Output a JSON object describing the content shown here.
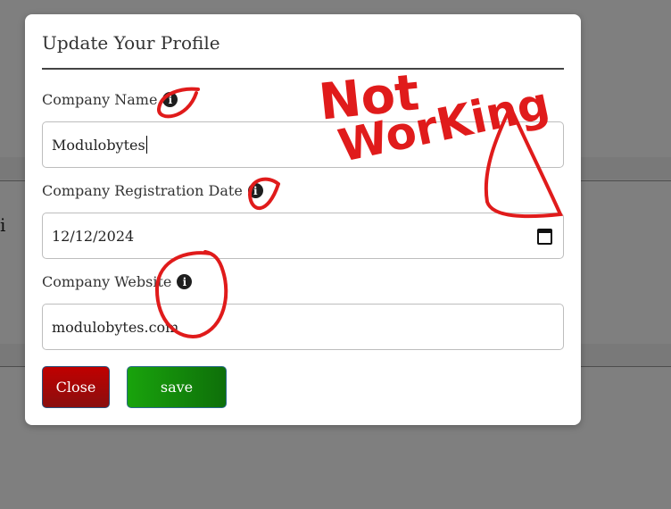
{
  "background": {
    "partial_text": "i"
  },
  "modal": {
    "title": "Update Your Profile",
    "fields": [
      {
        "label": "Company Name",
        "value": "Modulobytes",
        "icon": "info-icon"
      },
      {
        "label": "Company Registration Date",
        "value": "12/12/2024",
        "icon": "info-icon"
      },
      {
        "label": "Company Website",
        "value": "modulobytes.com",
        "icon": "info-icon"
      }
    ],
    "buttons": {
      "close_label": "Close",
      "save_label": "save"
    },
    "info_glyph": "i"
  },
  "annotations": {
    "text_line1": "Not",
    "text_line2": "WorKing",
    "color": "#e01b1b"
  },
  "colors": {
    "close_button": "#b00f0f",
    "save_button": "#12900b",
    "overlay": "#808080"
  }
}
